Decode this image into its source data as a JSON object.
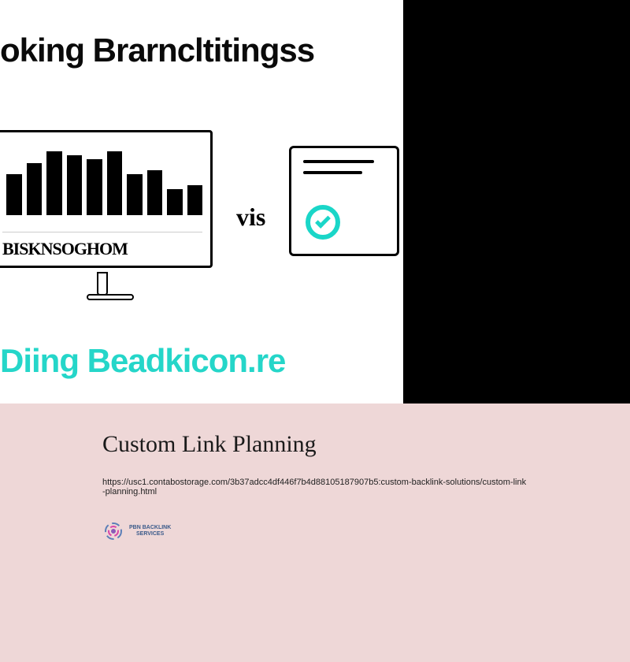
{
  "hero": {
    "top_headline": "oking Brarncltitingss",
    "bottom_headline": "Diing Beadkicon.re",
    "vis_label": "vis",
    "monitor_left_label": "BISKNSOGHOM",
    "bars": [
      55,
      70,
      85,
      80,
      75,
      85,
      55,
      60,
      35,
      40
    ]
  },
  "article": {
    "title": "Custom Link Planning",
    "url": "https://usc1.contabostorage.com/3b37adcc4df446f7b4d88105187907b5:custom-backlink-solutions/custom-link-planning.html"
  },
  "logo": {
    "line1": "PBN BACKLINK",
    "line2": "SERVICES"
  },
  "colors": {
    "teal": "#25d6c9",
    "pink_bg": "#eed7d7",
    "black": "#000000"
  }
}
